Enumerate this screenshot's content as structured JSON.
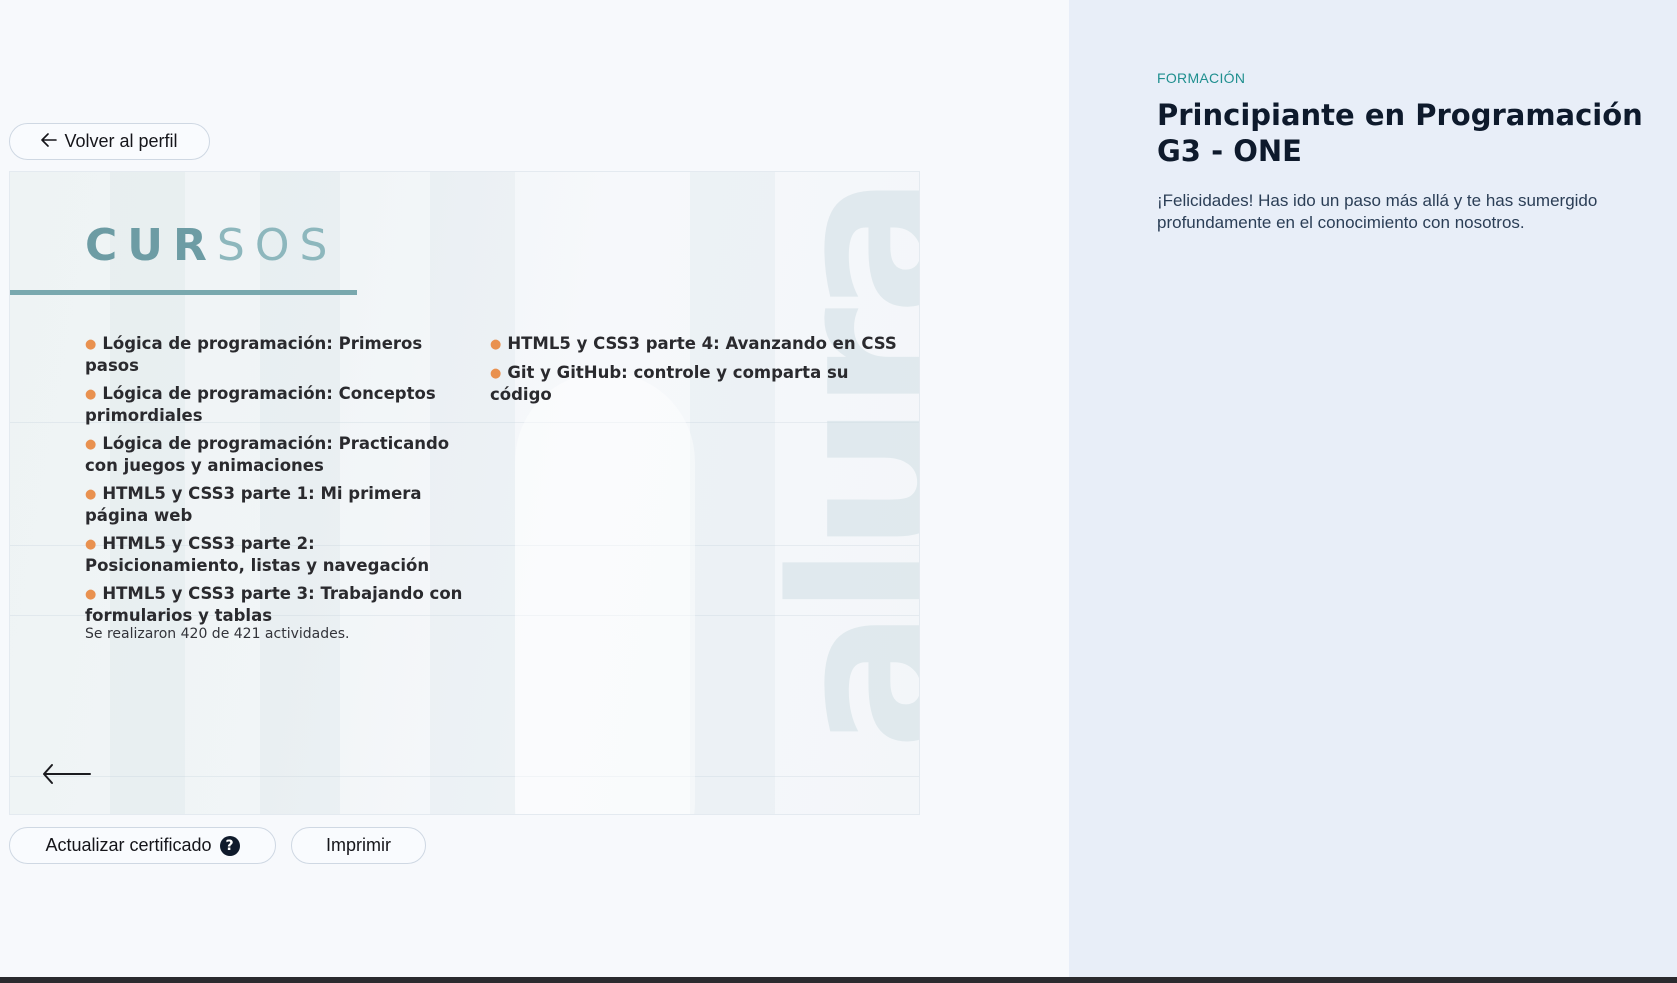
{
  "nav": {
    "back_label": "Volver al perfil"
  },
  "certificate": {
    "title_bold": "CUR",
    "title_light": "SOS",
    "watermark": "alura",
    "courses_col1": [
      "Lógica de programación: Primeros pasos",
      "Lógica de programación: Conceptos primordiales",
      "Lógica de programación: Practicando con juegos y animaciones",
      "HTML5 y CSS3 parte 1: Mi primera página web",
      "HTML5 y CSS3 parte 2: Posicionamiento, listas y navegación",
      "HTML5 y CSS3 parte 3: Trabajando con formularios y tablas"
    ],
    "courses_col2": [
      "HTML5 y CSS3 parte 4: Avanzando en CSS",
      "Git y GitHub: controle y comparta su código"
    ],
    "activities": "Se realizaron 420 de 421 actividades.",
    "prev_icon": "arrow-left-icon"
  },
  "actions": {
    "update_label": "Actualizar certificado",
    "help_icon": "question-circle-icon",
    "print_label": "Imprimir"
  },
  "sidebar": {
    "section_label": "FORMACIÓN",
    "title": "Principiante en Programación G3 - ONE",
    "description": "¡Felicidades! Has ido un paso más allá y te has sumergido profundamente en el conocimiento con nosotros."
  },
  "colors": {
    "accent_teal": "#1f8f8f",
    "bullet_orange": "#e9914f",
    "title_navy": "#0e1a2c",
    "right_panel_bg": "#e8eef8"
  }
}
